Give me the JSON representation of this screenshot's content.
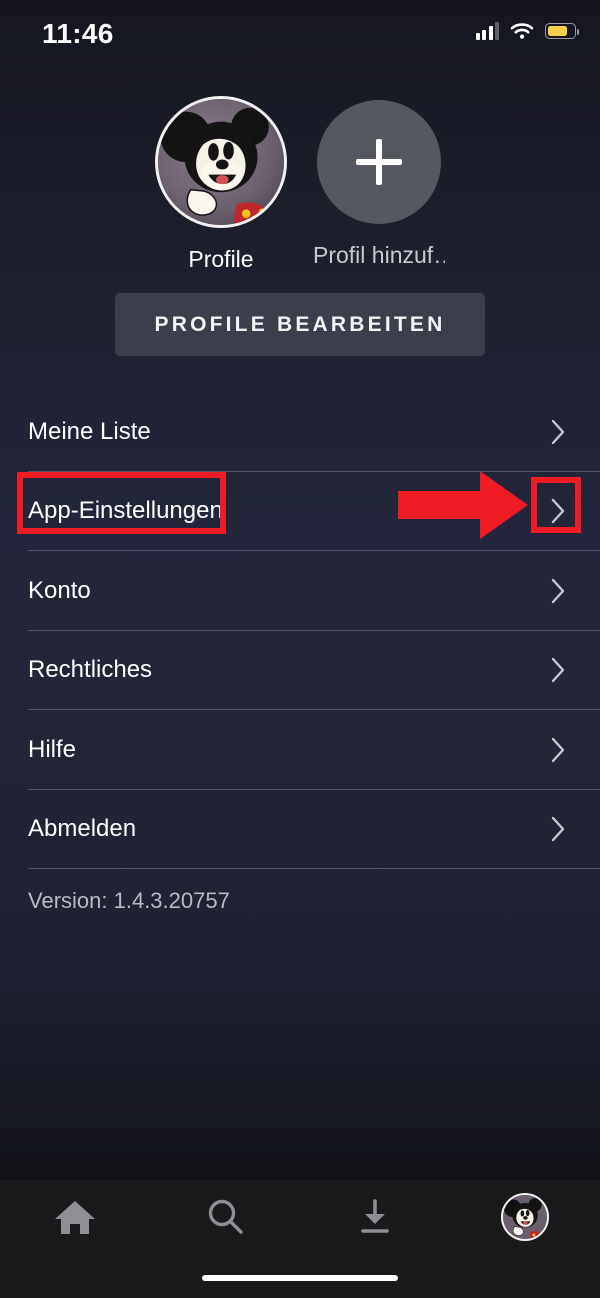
{
  "status_bar": {
    "time": "11:46",
    "signal_icon": "cellular-bars-icon",
    "wifi_icon": "wifi-icon",
    "battery_icon": "battery-icon",
    "battery_color": "#f5d14c",
    "battery_level_percent": 76
  },
  "profiles": {
    "items": [
      {
        "name": "Profile",
        "avatar": "mickey-mouse-avatar",
        "active": true
      },
      {
        "name": "Profil hinzuf…",
        "avatar": "add-profile-icon",
        "active": false
      }
    ],
    "edit_button_label": "PROFILE BEARBEITEN"
  },
  "menu": {
    "items": [
      {
        "label": "Meine Liste",
        "chevron": "chevron-right-icon"
      },
      {
        "label": "App-Einstellungen",
        "chevron": "chevron-right-icon",
        "highlighted": true
      },
      {
        "label": "Konto",
        "chevron": "chevron-right-icon"
      },
      {
        "label": "Rechtliches",
        "chevron": "chevron-right-icon"
      },
      {
        "label": "Hilfe",
        "chevron": "chevron-right-icon"
      },
      {
        "label": "Abmelden",
        "chevron": "chevron-right-icon"
      }
    ]
  },
  "version_text": "Version: 1.4.3.20757",
  "annotations": {
    "color": "#ee1c24",
    "highlight_label": "App-Einstellungen",
    "arrow_icon": "right-arrow-annotation",
    "boxes": [
      "app-settings-label-box",
      "app-settings-chevron-box"
    ]
  },
  "tab_bar": {
    "items": [
      {
        "icon": "home-icon",
        "active": false
      },
      {
        "icon": "search-icon",
        "active": false
      },
      {
        "icon": "download-icon",
        "active": false
      },
      {
        "icon": "profile-avatar-icon",
        "active": true
      }
    ],
    "icon_color": "#8e8e93"
  }
}
